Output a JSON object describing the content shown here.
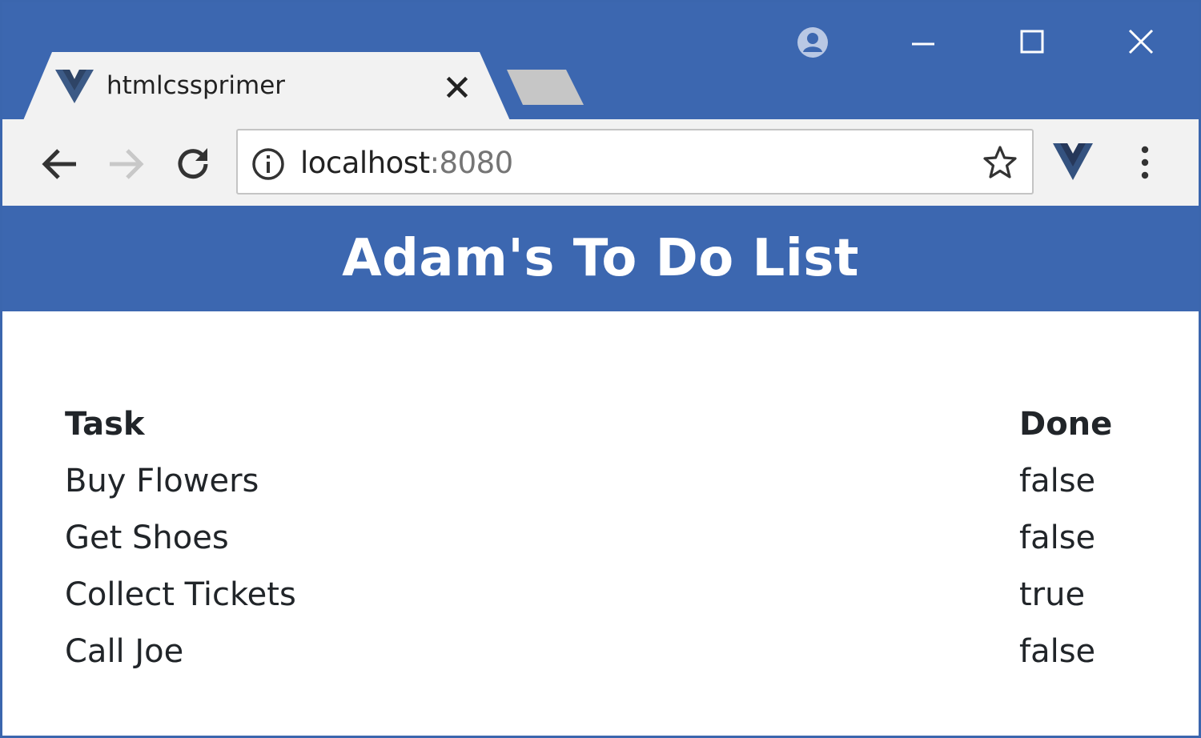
{
  "browser": {
    "tab": {
      "title": "htmlcssprimer"
    },
    "address_bar": {
      "host": "localhost",
      "port": ":8080"
    },
    "colors": {
      "frame": "#3c67b0",
      "toolbar": "#f2f2f2"
    }
  },
  "page": {
    "title": "Adam's To Do List",
    "table": {
      "headers": {
        "task": "Task",
        "done": "Done"
      },
      "rows": [
        {
          "task": "Buy Flowers",
          "done": "false"
        },
        {
          "task": "Get Shoes",
          "done": "false"
        },
        {
          "task": "Collect Tickets",
          "done": "true"
        },
        {
          "task": "Call Joe",
          "done": "false"
        }
      ]
    }
  },
  "icons": {
    "favicon": "vue-logo-icon",
    "tab_close": "close-icon",
    "profile": "account-icon",
    "minimize": "minimize-icon",
    "maximize": "maximize-icon",
    "close": "close-icon",
    "back": "arrow-left-icon",
    "forward": "arrow-right-icon",
    "reload": "reload-icon",
    "info": "info-icon",
    "bookmark": "star-icon",
    "extension": "vue-logo-icon",
    "menu": "kebab-menu-icon"
  }
}
